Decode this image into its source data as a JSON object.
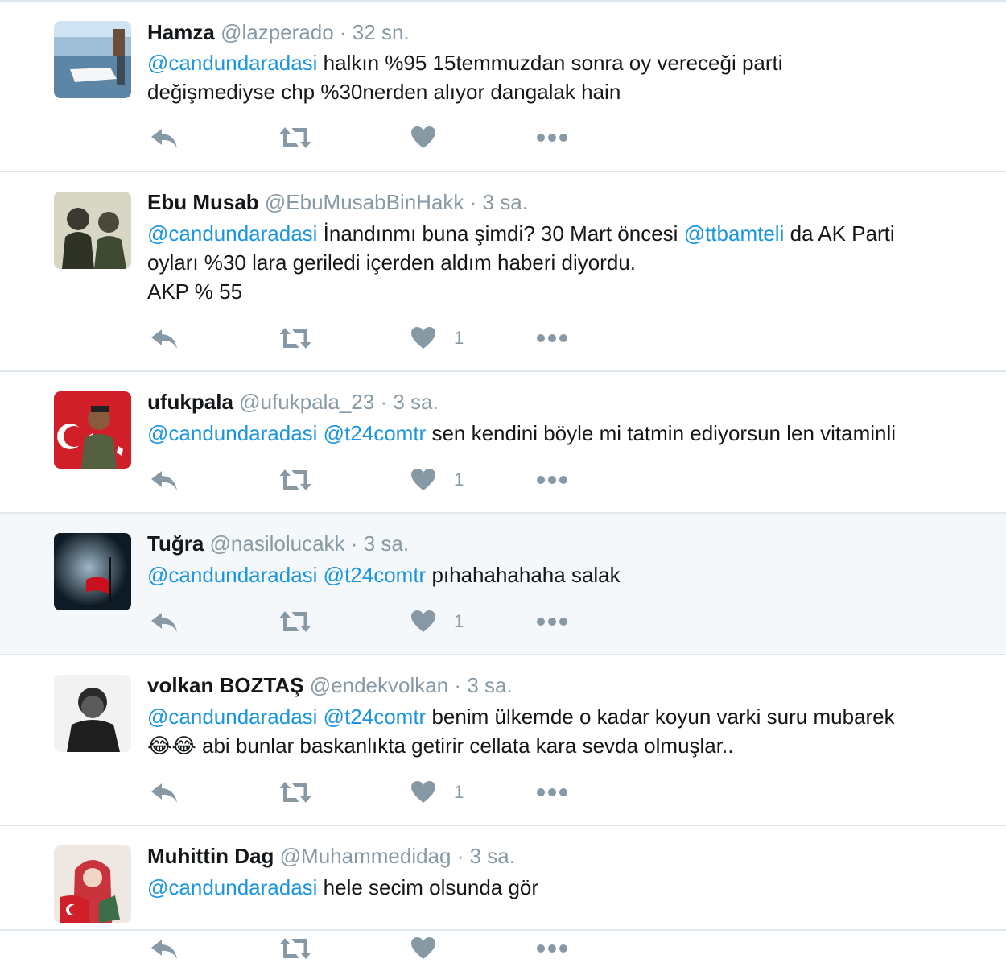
{
  "tweets": [
    {
      "name": "Hamza",
      "handle": "@lazperado",
      "separator": "·",
      "time": "32 sn.",
      "lines": [
        [
          {
            "t": "@candundaradasi",
            "m": true
          },
          {
            "t": " halkın %95 15temmuzdan sonra oy vereceği parti",
            "m": false
          }
        ],
        [
          {
            "t": "değişmediyse chp %30nerden alıyor dangalak hain",
            "m": false
          }
        ]
      ],
      "like_count": "",
      "highlighted": false
    },
    {
      "name": "Ebu Musab",
      "handle": "@EbuMusabBinHakk",
      "separator": "·",
      "time": "3 sa.",
      "lines": [
        [
          {
            "t": "@candundaradasi",
            "m": true
          },
          {
            "t": " İnandınmı buna şimdi? 30 Mart öncesi ",
            "m": false
          },
          {
            "t": "@ttbamteli",
            "m": true
          },
          {
            "t": " da AK Parti",
            "m": false
          }
        ],
        [
          {
            "t": "oyları %30 lara geriledi içerden aldım haberi diyordu.",
            "m": false
          }
        ],
        [
          {
            "t": "AKP % 55",
            "m": false
          }
        ]
      ],
      "like_count": "1",
      "highlighted": false
    },
    {
      "name": "ufukpala",
      "handle": "@ufukpala_23",
      "separator": "·",
      "time": "3 sa.",
      "lines": [
        [
          {
            "t": "@candundaradasi",
            "m": true
          },
          {
            "t": " ",
            "m": false
          },
          {
            "t": "@t24comtr",
            "m": true
          },
          {
            "t": " sen kendini böyle mi tatmin ediyorsun len vitaminli",
            "m": false
          }
        ]
      ],
      "like_count": "1",
      "highlighted": false
    },
    {
      "name": "Tuğra",
      "handle": "@nasilolucakk",
      "separator": "·",
      "time": "3 sa.",
      "lines": [
        [
          {
            "t": "@candundaradasi",
            "m": true
          },
          {
            "t": " ",
            "m": false
          },
          {
            "t": "@t24comtr",
            "m": true
          },
          {
            "t": " pıhahahahaha salak",
            "m": false
          }
        ]
      ],
      "like_count": "1",
      "highlighted": true
    },
    {
      "name": "volkan BOZTAŞ",
      "handle": "@endekvolkan",
      "separator": "·",
      "time": "3 sa.",
      "lines": [
        [
          {
            "t": "@candundaradasi",
            "m": true
          },
          {
            "t": " ",
            "m": false
          },
          {
            "t": "@t24comtr",
            "m": true
          },
          {
            "t": "  benim ülkemde o kadar koyun varki suru mubarek",
            "m": false
          }
        ],
        [
          {
            "t": "😂😂",
            "m": false,
            "emoji": true
          },
          {
            "t": " abi bunlar baskanlıkta getirir cellata kara sevda olmuşlar..",
            "m": false
          }
        ]
      ],
      "like_count": "1",
      "highlighted": false
    },
    {
      "name": "Muhittin Dag",
      "handle": "@Muhammedidag",
      "separator": "·",
      "time": "3 sa.",
      "lines": [
        [
          {
            "t": "@candundaradasi",
            "m": true
          },
          {
            "t": " hele secim olsunda gör",
            "m": false
          }
        ]
      ],
      "like_count": "",
      "highlighted": false
    }
  ],
  "icons": {
    "reply": "reply-icon",
    "retweet": "retweet-icon",
    "like": "heart-icon",
    "more": "more-icon"
  },
  "colors": {
    "mention": "#1b95e0",
    "meta": "#8899a6",
    "divider": "#e1e8ed",
    "highlight_bg": "#f5f8fa"
  }
}
